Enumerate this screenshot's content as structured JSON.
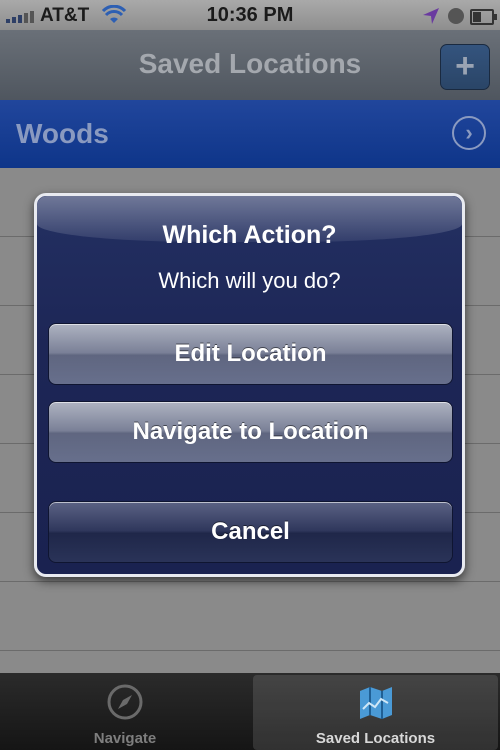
{
  "status_bar": {
    "carrier": "AT&T",
    "time": "10:36 PM"
  },
  "nav_bar": {
    "title": "Saved Locations",
    "add_label": "+"
  },
  "list": {
    "items": [
      {
        "label": "Woods"
      }
    ]
  },
  "alert": {
    "title": "Which Action?",
    "message": "Which will you do?",
    "buttons": {
      "edit": "Edit Location",
      "navigate": "Navigate to Location",
      "cancel": "Cancel"
    }
  },
  "tab_bar": {
    "tabs": [
      {
        "label": "Navigate",
        "icon": "compass-icon",
        "selected": false
      },
      {
        "label": "Saved Locations",
        "icon": "map-icon",
        "selected": true
      }
    ]
  },
  "colors": {
    "nav_bar": "#555b63",
    "row_selected": "#163c90",
    "alert_bg": "#1d2656"
  }
}
